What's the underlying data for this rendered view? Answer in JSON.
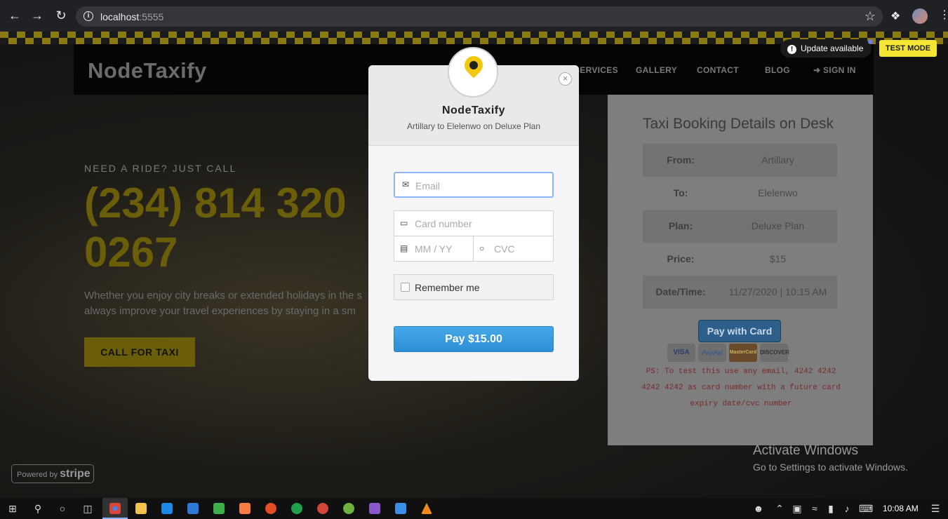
{
  "browser": {
    "url_host": "localhost",
    "url_port": ":5555"
  },
  "site": {
    "logo": "NodeTaxify",
    "nav": [
      "SERVICES",
      "GALLERY",
      "CONTACT",
      "BLOG",
      "SIGN IN"
    ],
    "hero_kicker": "NEED A RIDE? JUST CALL",
    "hero_phone": "(234) 814 320 0267",
    "hero_text_line1": "Whether you enjoy city breaks or extended holidays in the s",
    "hero_text_line2": "always improve your travel experiences by staying in a sm",
    "call_button": "CALL FOR TAXI",
    "update_available": "Update available",
    "test_mode": "TEST MODE"
  },
  "booking": {
    "title": "Taxi Booking Details on Desk",
    "rows": [
      {
        "label": "From:",
        "value": "Artillary"
      },
      {
        "label": "To:",
        "value": "Elelenwo"
      },
      {
        "label": "Plan:",
        "value": "Deluxe Plan"
      },
      {
        "label": "Price:",
        "value": "$15"
      },
      {
        "label": "Date/Time:",
        "value": "11/27/2020 | 10:15 AM"
      }
    ],
    "pay_button": "Pay with Card",
    "card_logos": [
      "VISA",
      "PayPal",
      "MasterCard",
      "DISCOVER"
    ],
    "note": "PS: To test this use any email, 4242 4242 4242 4242 as card number with a future card expiry date/cvc number"
  },
  "modal": {
    "title": "NodeTaxify",
    "subtitle": "Artillary to Elelenwo on Deluxe Plan",
    "email_placeholder": "Email",
    "card_placeholder": "Card number",
    "expiry_placeholder": "MM / YY",
    "cvc_placeholder": "CVC",
    "remember_label": "Remember me",
    "pay_button": "Pay $15.00"
  },
  "overlay": {
    "activate_title": "Activate Windows",
    "activate_sub": "Go to Settings to activate Windows.",
    "powered_by": "Powered by",
    "stripe": "stripe"
  },
  "taskbar": {
    "time": "10:08 AM"
  },
  "colors": {
    "accent_yellow": "#f5e633",
    "stripe_blue": "#2d8fd5"
  }
}
